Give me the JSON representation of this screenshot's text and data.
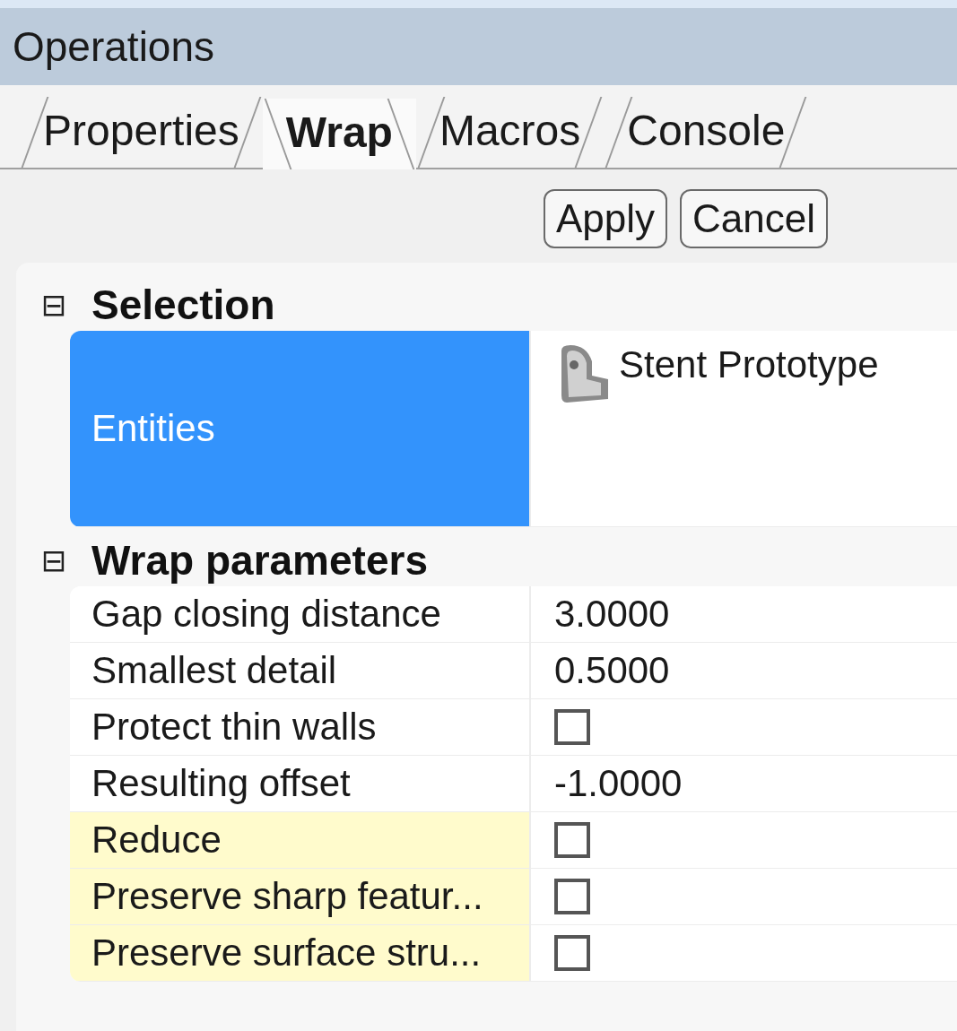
{
  "panel": {
    "title": "Operations"
  },
  "tabs": [
    {
      "label": "Properties",
      "selected": false
    },
    {
      "label": "Wrap",
      "selected": true
    },
    {
      "label": "Macros",
      "selected": false
    },
    {
      "label": "Console",
      "selected": false
    }
  ],
  "buttons": [
    "Apply",
    "Cancel"
  ],
  "sections": [
    {
      "title": "Selection",
      "toggle": "⊟",
      "rows": [
        {
          "kind": "entity",
          "label": "Entities",
          "value": "Stent Prototype",
          "selected": true
        }
      ]
    },
    {
      "title": "Wrap parameters",
      "toggle": "⊟",
      "rows": [
        {
          "kind": "value",
          "label": "Gap closing distance",
          "value": "3.0000",
          "selected": false,
          "highlighted": false
        },
        {
          "kind": "value",
          "label": "Smallest detail",
          "value": "0.5000",
          "selected": false,
          "highlighted": false
        },
        {
          "kind": "checkbox",
          "label": "Protect thin walls",
          "checked": false,
          "selected": false,
          "highlighted": false
        },
        {
          "kind": "value",
          "label": "Resulting offset",
          "value": "-1.0000",
          "selected": false,
          "highlighted": false
        },
        {
          "kind": "checkbox",
          "label": "Reduce",
          "checked": false,
          "selected": false,
          "highlighted": true
        },
        {
          "kind": "checkbox",
          "label": "Preserve sharp featur...",
          "checked": false,
          "selected": false,
          "highlighted": true
        },
        {
          "kind": "checkbox",
          "label": "Preserve surface stru...",
          "checked": false,
          "selected": false,
          "highlighted": true
        }
      ]
    }
  ]
}
